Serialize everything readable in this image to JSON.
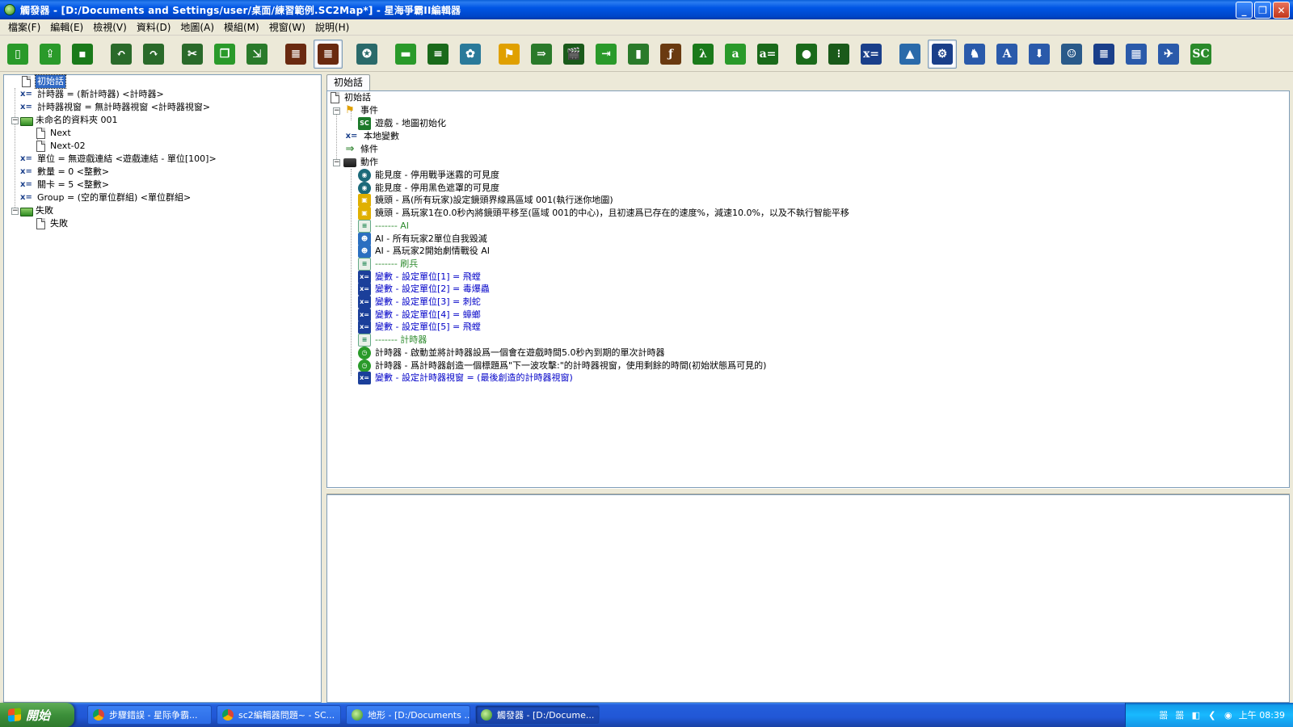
{
  "window": {
    "title": "觸發器 - [D:/Documents and Settings/user/桌面/練習範例.SC2Map*] - 星海爭霸II編輯器",
    "minimize": "_",
    "restore": "❐",
    "close": "✕"
  },
  "menu": [
    "檔案(F)",
    "編輯(E)",
    "檢視(V)",
    "資料(D)",
    "地圖(A)",
    "模組(M)",
    "視窗(W)",
    "說明(H)"
  ],
  "toolbar": {
    "icons": [
      "new-icon",
      "open-icon",
      "save-icon",
      "undo-icon",
      "redo-icon",
      "cut-icon",
      "copy-icon",
      "paste-icon",
      "trigger-list-icon",
      "trigger-editor-icon",
      "new-trigger-icon",
      "new-folder-icon",
      "new-element-icon",
      "new-gear-icon",
      "new-event-icon",
      "new-condition-icon",
      "new-action-icon",
      "new-action-def-icon",
      "new-script-icon",
      "new-function-icon",
      "new-lambda-icon",
      "new-a-icon",
      "new-preset-icon",
      "new-record-icon",
      "new-list-icon",
      "new-variable-icon",
      "terrain-icon",
      "trigger-module-icon",
      "units-icon",
      "text-icon",
      "import-icon",
      "ai-icon",
      "data-icon",
      "cutscene-icon",
      "plane-icon",
      "sc-icon"
    ],
    "glyphs": [
      "▯",
      "⇪",
      "▪",
      "↶",
      "↷",
      "✂",
      "❐",
      "⇲",
      "≣",
      "≣",
      "✪",
      "▬",
      "≡",
      "✿",
      "⚑",
      "⇒",
      "🎬",
      "⇥",
      "▮",
      "ƒ",
      "λ",
      "a",
      "a=",
      "●",
      "⁝",
      "x=",
      "▲",
      "⚙",
      "♞",
      "A",
      "⬇",
      "☺",
      "≣",
      "▦",
      "✈",
      "SC"
    ],
    "colors": [
      "#2a9a2a",
      "#2a9a2a",
      "#1a7a1a",
      "#2a6a2a",
      "#2a6a2a",
      "#2a6a2a",
      "#2a9a2a",
      "#2a7a2a",
      "#6a2a10",
      "#6a2a10",
      "#2a6a6a",
      "#2a9a2a",
      "#1a6a1a",
      "#2a7a9a",
      "#e0a000",
      "#2a7a2a",
      "#1a5a1a",
      "#2a9a2a",
      "#2a7a2a",
      "#6a3a10",
      "#1a7a1a",
      "#2a9a2a",
      "#1a6a1a",
      "#1a6a1a",
      "#1a5a1a",
      "#1a3f8a",
      "#2a6aaa",
      "#1a3f8a",
      "#2a5aaa",
      "#2a5aaa",
      "#2a5aaa",
      "#2a5a8a",
      "#1a3f8a",
      "#2a5aaa",
      "#2a5aaa",
      "#2a8a2a"
    ]
  },
  "left_tree": {
    "root": "初始話",
    "items": [
      {
        "type": "var",
        "label": "計時器 = (新計時器) <計時器>"
      },
      {
        "type": "var",
        "label": "計時器視窗 = 無計時器視窗 <計時器視窗>"
      },
      {
        "type": "folder",
        "label": "未命名的資料夾 001"
      },
      {
        "type": "page",
        "label": "Next"
      },
      {
        "type": "page",
        "label": "Next-02"
      },
      {
        "type": "var",
        "label": "單位 = 無遊戲連結 <遊戲連結 - 單位[100]>"
      },
      {
        "type": "var",
        "label": "數量 = 0 <整數>"
      },
      {
        "type": "var",
        "label": "關卡 = 5 <整數>"
      },
      {
        "type": "var",
        "label": "Group = (空的單位群組) <單位群組>"
      },
      {
        "type": "folder",
        "label": "失敗"
      },
      {
        "type": "page",
        "label": "失敗"
      }
    ]
  },
  "tab": {
    "label": "初始話"
  },
  "trigger": {
    "name": "初始話",
    "events_label": "事件",
    "event_1": "遊戲 - 地圖初始化",
    "local_vars_label": "本地變數",
    "conditions_label": "條件",
    "actions_label": "動作",
    "actions": [
      {
        "icon": "i-eye",
        "glyph": "◉",
        "text": "能見度 - 停用戰爭迷霧的可見度",
        "cls": ""
      },
      {
        "icon": "i-eye",
        "glyph": "◉",
        "text": "能見度 - 停用黑色遮罩的可見度",
        "cls": ""
      },
      {
        "icon": "i-cam",
        "glyph": "▣",
        "text": "鏡頭 - 爲(所有玩家)設定鏡頭界線爲區域 001(執行迷你地圖)",
        "cls": ""
      },
      {
        "icon": "i-cam",
        "glyph": "▣",
        "text": "鏡頭 - 爲玩家1在0.0秒內將鏡頭平移至(區域 001的中心)，且初速爲已存在的速度%，減速10.0%，以及不執行智能平移",
        "cls": ""
      },
      {
        "icon": "i-cmt",
        "glyph": "≡",
        "text": "------- AI",
        "cls": "txt-green"
      },
      {
        "icon": "i-ai",
        "glyph": "☻",
        "text": "AI - 所有玩家2單位自我毀滅",
        "cls": ""
      },
      {
        "icon": "i-ai",
        "glyph": "☻",
        "text": "AI - 爲玩家2開始劇情戰役 AI",
        "cls": ""
      },
      {
        "icon": "i-cmt",
        "glyph": "≡",
        "text": "------- 刷兵",
        "cls": "txt-green"
      },
      {
        "icon": "i-var",
        "glyph": "x=",
        "text": "變數 - 設定單位[1] = 飛螳",
        "cls": "txt-blue"
      },
      {
        "icon": "i-var",
        "glyph": "x=",
        "text": "變數 - 設定單位[2] = 毒爆蟲",
        "cls": "txt-blue"
      },
      {
        "icon": "i-var",
        "glyph": "x=",
        "text": "變數 - 設定單位[3] = 刺蛇",
        "cls": "txt-blue"
      },
      {
        "icon": "i-var",
        "glyph": "x=",
        "text": "變數 - 設定單位[4] = 蟑螂",
        "cls": "txt-blue"
      },
      {
        "icon": "i-var",
        "glyph": "x=",
        "text": "變數 - 設定單位[5] = 飛螳",
        "cls": "txt-blue"
      },
      {
        "icon": "i-cmt",
        "glyph": "≡",
        "text": "------- 計時器",
        "cls": "txt-green"
      },
      {
        "icon": "i-timer",
        "glyph": "◷",
        "text": "計時器 - 啟動並將計時器設爲一個會在遊戲時間5.0秒內到期的單次計時器",
        "cls": ""
      },
      {
        "icon": "i-timer",
        "glyph": "◷",
        "text": "計時器 - 爲計時器創造一個標題爲\"下一波攻擊:\"的計時器視窗，使用剩餘的時間(初始狀態爲可見的)",
        "cls": ""
      },
      {
        "icon": "i-var",
        "glyph": "x=",
        "text": "變數 - 設定計時器視窗 = (最後創造的計時器視窗)",
        "cls": "txt-blue"
      }
    ]
  },
  "taskbar": {
    "start": "開始",
    "tasks": [
      {
        "icon": "chrome",
        "label": "步驟錯誤 - 星际争霸..."
      },
      {
        "icon": "chrome",
        "label": "sc2編輯器問題~ - SC..."
      },
      {
        "icon": "sc2",
        "label": "地形 - [D:/Documents ..."
      },
      {
        "icon": "sc2",
        "label": "觸發器 - [D:/Docume..."
      }
    ],
    "tray_icons": [
      "ime-icon",
      "ime-icon-2",
      "monitor-icon",
      "network-icon",
      "chrome-tray-icon"
    ],
    "tray_glyphs": [
      "噐",
      "噐",
      "◧",
      "❮",
      "◉"
    ],
    "clock": "上午 08:39"
  }
}
